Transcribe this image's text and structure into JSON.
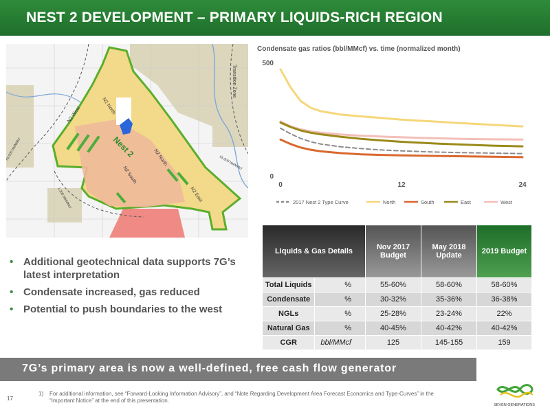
{
  "header": {
    "title": "NEST 2 DEVELOPMENT – PRIMARY LIQUIDS-RICH REGION"
  },
  "map": {
    "labels": {
      "nest2": "Nest 2",
      "n2_north_top": "N2 North",
      "n2_west": "N2 West",
      "n2_north_right": "N2 North",
      "n2_south": "N2 South",
      "n2_east": "N2 East",
      "transition_zone": "Transition Zone",
      "iso_left": "55,000 bbl/MMcf",
      "iso_bottom": "1,200 bbl/MMcf",
      "iso_right": "55,000 bbl/MMcf"
    },
    "colors": {
      "liquids_yellow": "#f3d98a",
      "salmon": "#f0b99a",
      "grey_area": "#d8d3bc",
      "red_zone": "#f08a84",
      "outline_green": "#5aae2b",
      "lake_blue": "#2a66d9"
    }
  },
  "chart_data": {
    "type": "line",
    "title": "Condensate gas ratios (bbl/MMcf) vs. time (normalized month)",
    "xlabel": "",
    "ylabel": "",
    "xlim": [
      0,
      24
    ],
    "ylim": [
      0,
      500
    ],
    "x_ticks": [
      "0",
      "12",
      "24"
    ],
    "y_ticks": [
      "0",
      "500"
    ],
    "grid": false,
    "legend": "bottom",
    "x": [
      0,
      1,
      2,
      3,
      4,
      6,
      8,
      10,
      12,
      15,
      18,
      21,
      24
    ],
    "series": [
      {
        "name": "2017 Nest 2 Type Curve",
        "color": "#8c8c8c",
        "dash": true,
        "values": [
          210,
          185,
          165,
          150,
          140,
          128,
          120,
          114,
          110,
          105,
          102,
          100,
          98
        ]
      },
      {
        "name": "North",
        "color": "#f5d77a",
        "dash": false,
        "values": [
          470,
          390,
          330,
          300,
          285,
          270,
          262,
          255,
          248,
          240,
          232,
          225,
          218
        ]
      },
      {
        "name": "South",
        "color": "#d9682e",
        "dash": false,
        "values": [
          160,
          140,
          125,
          115,
          108,
          100,
          95,
          92,
          90,
          88,
          86,
          84,
          82
        ]
      },
      {
        "name": "East",
        "color": "#9a8a1a",
        "dash": false,
        "values": [
          235,
          215,
          200,
          190,
          183,
          172,
          163,
          156,
          150,
          143,
          138,
          133,
          130
        ]
      },
      {
        "name": "West",
        "color": "#f3bfb8",
        "dash": false,
        "values": [
          240,
          218,
          205,
          196,
          190,
          182,
          177,
          173,
          170,
          166,
          163,
          161,
          160
        ]
      }
    ]
  },
  "bullets": [
    "Additional geotechnical data supports 7G’s latest interpretation",
    "Condensate increased, gas reduced",
    "Potential to push boundaries to the west"
  ],
  "table": {
    "head": {
      "details": "Liquids & Gas Details",
      "nov2017": "Nov 2017 Budget",
      "may2018": "May 2018 Update",
      "b2019": "2019 Budget"
    },
    "rows": [
      {
        "label": "Total Liquids",
        "unit": "%",
        "nov2017": "55-60%",
        "may2018": "58-60%",
        "b2019": "58-60%"
      },
      {
        "label": "Condensate",
        "unit": "%",
        "nov2017": "30-32%",
        "may2018": "35-36%",
        "b2019": "36-38%"
      },
      {
        "label": "NGLs",
        "unit": "%",
        "nov2017": "25-28%",
        "may2018": "23-24%",
        "b2019": "22%"
      },
      {
        "label": "Natural Gas",
        "unit": "%",
        "nov2017": "40-45%",
        "may2018": "40-42%",
        "b2019": "40-42%"
      },
      {
        "label": "CGR",
        "unit": "bbl/MMcf",
        "nov2017": "125",
        "may2018": "145-155",
        "b2019": "159"
      }
    ]
  },
  "banner": {
    "text": "7G’s primary area is now a well-defined, free cash flow generator"
  },
  "page_number": "17",
  "footnote": {
    "number": "1)",
    "line1": "For additional information, see “Forward-Looking Information Advisory”, and “Note Regarding Development Area Forecast Economics and Type-Curves” in the",
    "line2": "“Important Notice” at the end of this presentation."
  },
  "logo": {
    "text": "SEVEN GENERATIONS",
    "colors": {
      "green": "#3fa535",
      "yellow": "#e6c11c"
    }
  }
}
